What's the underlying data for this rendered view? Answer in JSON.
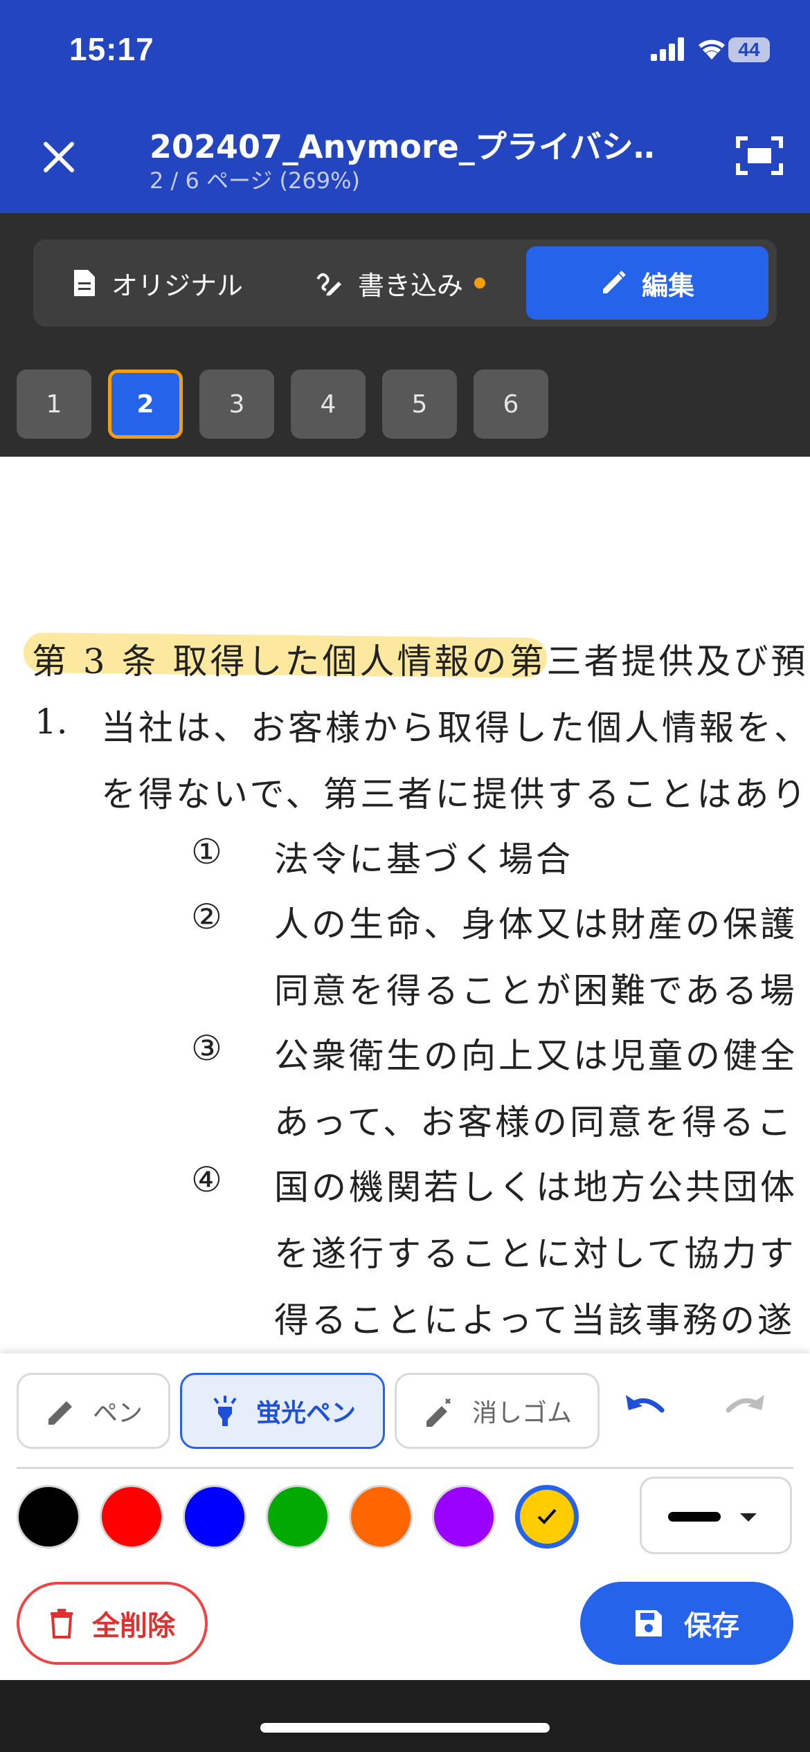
{
  "status_bar": {
    "time": "15:17",
    "battery": "44"
  },
  "header": {
    "title": "202407_Anymore_プライバシ…",
    "subtitle": "2 / 6 ページ (269%)",
    "close_icon": "close-icon",
    "fit_icon": "fit-screen-icon"
  },
  "mode_tabs": [
    {
      "label": "オリジナル",
      "icon": "document-icon",
      "active": false
    },
    {
      "label": "書き込み",
      "icon": "draw-icon",
      "active": false,
      "has_indicator": true
    },
    {
      "label": "編集",
      "icon": "pencil-icon",
      "active": true
    }
  ],
  "pages": [
    "1",
    "2",
    "3",
    "4",
    "5",
    "6"
  ],
  "current_page": "2",
  "document": {
    "heading": "第 3 条  取得した個人情報の第三者提供及び預",
    "item_number": "1.",
    "item_line1": "当社は、お客様から取得した個人情報を、",
    "item_line2": "を得ないで、第三者に提供することはあり",
    "sub_items": [
      {
        "num": "①",
        "lines": [
          "法令に基づく場合"
        ]
      },
      {
        "num": "②",
        "lines": [
          "人の生命、身体又は財産の保護",
          "同意を得ることが困難である場"
        ]
      },
      {
        "num": "③",
        "lines": [
          "公衆衛生の向上又は児童の健全",
          "あって、お客様の同意を得るこ"
        ]
      },
      {
        "num": "④",
        "lines": [
          "国の機関若しくは地方公共団体",
          "を遂行することに対して協力す",
          "得ることによって当該事務の遂"
        ]
      }
    ]
  },
  "tools": {
    "pen": "ペン",
    "highlighter": "蛍光ペン",
    "eraser": "消しゴム",
    "selected_tool": "蛍光ペン"
  },
  "colors": [
    "#000000",
    "#ff0000",
    "#0000ff",
    "#00aa00",
    "#ff6600",
    "#9900ff",
    "#ffcc00"
  ],
  "selected_color": "#ffcc00",
  "actions": {
    "clear_all": "全削除",
    "save": "保存"
  }
}
